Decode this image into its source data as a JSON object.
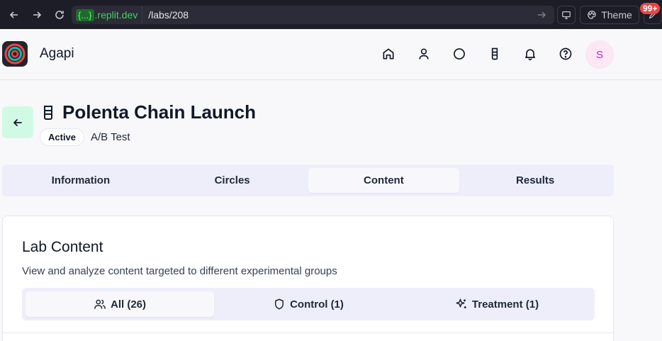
{
  "browser": {
    "url_domain_badge": "{...}",
    "url_domain": ".replit.dev",
    "url_path": "/labs/208",
    "theme_label": "Theme",
    "notification_count": "99+"
  },
  "header": {
    "app_name": "Agapi",
    "avatar_initial": "S",
    "icons": [
      "home-icon",
      "user-icon",
      "circle-icon",
      "beaker-icon",
      "bell-icon",
      "help-icon"
    ]
  },
  "lab": {
    "title": "Polenta Chain Launch",
    "status": "Active",
    "type": "A/B Test"
  },
  "tabs": [
    {
      "label": "Information",
      "active": false
    },
    {
      "label": "Circles",
      "active": false
    },
    {
      "label": "Content",
      "active": true
    },
    {
      "label": "Results",
      "active": false
    }
  ],
  "content_card": {
    "title": "Lab Content",
    "description": "View and analyze content targeted to different experimental groups",
    "filters": [
      {
        "label": "All (26)",
        "icon": "users-icon",
        "active": true
      },
      {
        "label": "Control (1)",
        "icon": "shield-icon",
        "active": false
      },
      {
        "label": "Treatment (1)",
        "icon": "sparkles-icon",
        "active": false
      }
    ]
  },
  "colors": {
    "accent_back_button": "#d1fae5",
    "avatar_bg": "#fce7f3",
    "avatar_text": "#c026d3",
    "url_domain": "#42d25c",
    "badge": "#ef4444"
  }
}
